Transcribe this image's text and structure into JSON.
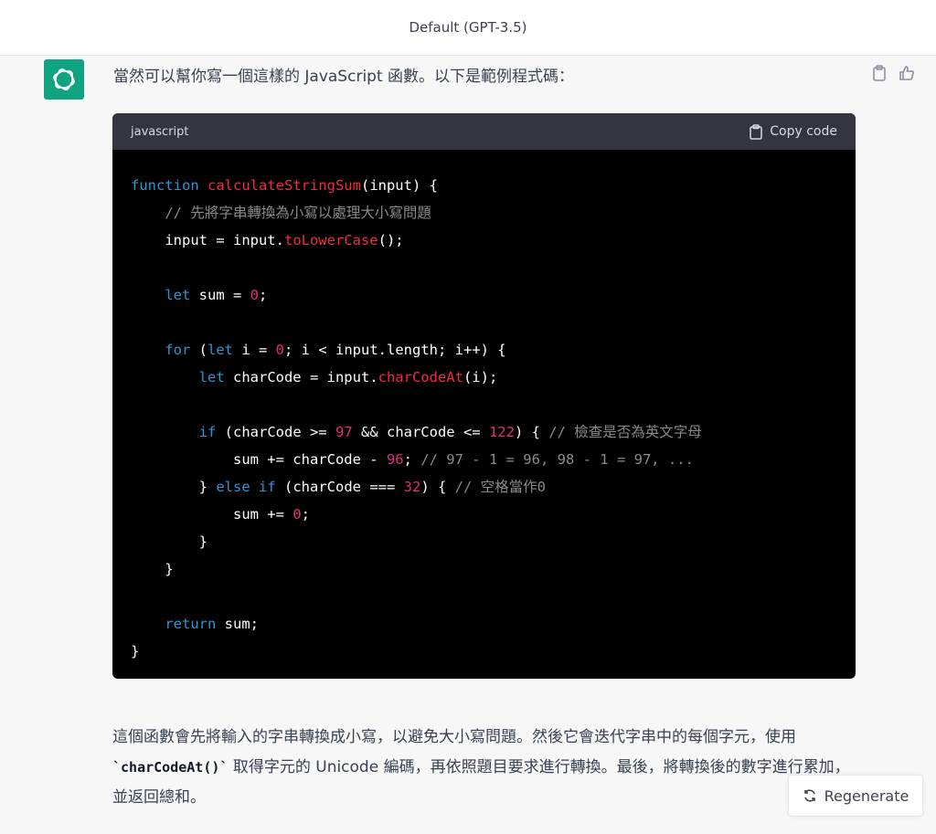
{
  "header": {
    "model_label": "Default (GPT-3.5)"
  },
  "message": {
    "intro": "當然可以幫你寫一個這樣的 JavaScript 函數。以下是範例程式碼：",
    "code_block": {
      "language": "javascript",
      "copy_label": "Copy code",
      "lines": [
        "function calculateStringSum(input) {",
        "  // 先將字串轉換為小寫以處理大小寫問題",
        "  input = input.toLowerCase();",
        "",
        "  let sum = 0;",
        "",
        "  for (let i = 0; i < input.length; i++) {",
        "    let charCode = input.charCodeAt(i);",
        "",
        "    if (charCode >= 97 && charCode <= 122) { // 檢查是否為英文字母",
        "      sum += charCode - 96; // 97 - 1 = 96, 98 - 1 = 97, ...",
        "    } else if (charCode === 32) { // 空格當作0",
        "      sum += 0;",
        "    }",
        "  }",
        "",
        "  return sum;",
        "}"
      ]
    },
    "explanation": {
      "part1": "這個函數會先將輸入的字串轉換成小寫，以避免大小寫問題。然後它會迭代字串中的每個字元，使用 ",
      "code": "`charCodeAt()`",
      "part2": " 取得字元的 Unicode 編碼，再依照題目要求進行轉換。最後，將轉換後的數字進行累加，並返回總和。"
    }
  },
  "actions": {
    "regenerate_label": "Regenerate"
  },
  "icons": [
    "chatgpt-logo-icon",
    "clipboard-icon",
    "thumbs-up-icon",
    "copy-icon",
    "refresh-icon"
  ],
  "colors": {
    "brand": "#10a37f",
    "keyword": "#2e95d3",
    "function": "#f22c3d",
    "number": "#df3079",
    "comment": "#8a8a8a"
  }
}
